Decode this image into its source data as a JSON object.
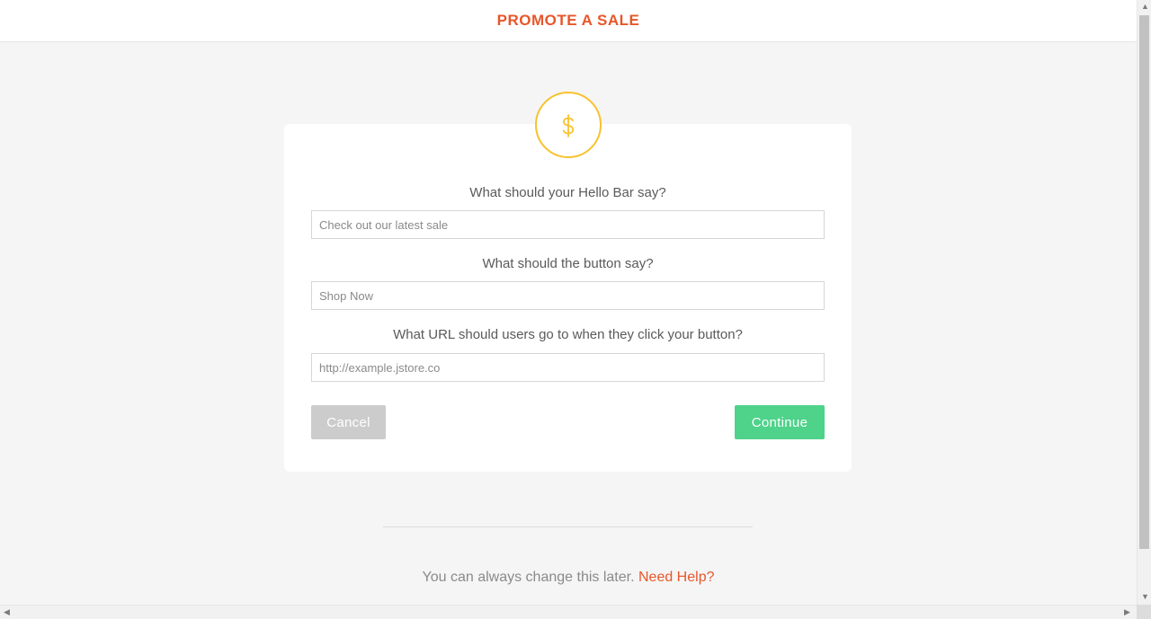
{
  "header": {
    "title": "PROMOTE A SALE"
  },
  "badge": {
    "icon": "dollar-icon",
    "color": "#f8c22e"
  },
  "form": {
    "message": {
      "label": "What should your Hello Bar say?",
      "placeholder": "Check out our latest sale",
      "value": ""
    },
    "button_text": {
      "label": "What should the button say?",
      "placeholder": "Shop Now",
      "value": ""
    },
    "url": {
      "label": "What URL should users go to when they click your button?",
      "placeholder": "http://example.jstore.co",
      "value": ""
    }
  },
  "actions": {
    "cancel_label": "Cancel",
    "continue_label": "Continue"
  },
  "footer": {
    "text": "You can always change this later.",
    "help_link": "Need Help?"
  },
  "colors": {
    "accent": "#e8562a",
    "continue": "#4fd28a",
    "cancel": "#cccccc"
  }
}
